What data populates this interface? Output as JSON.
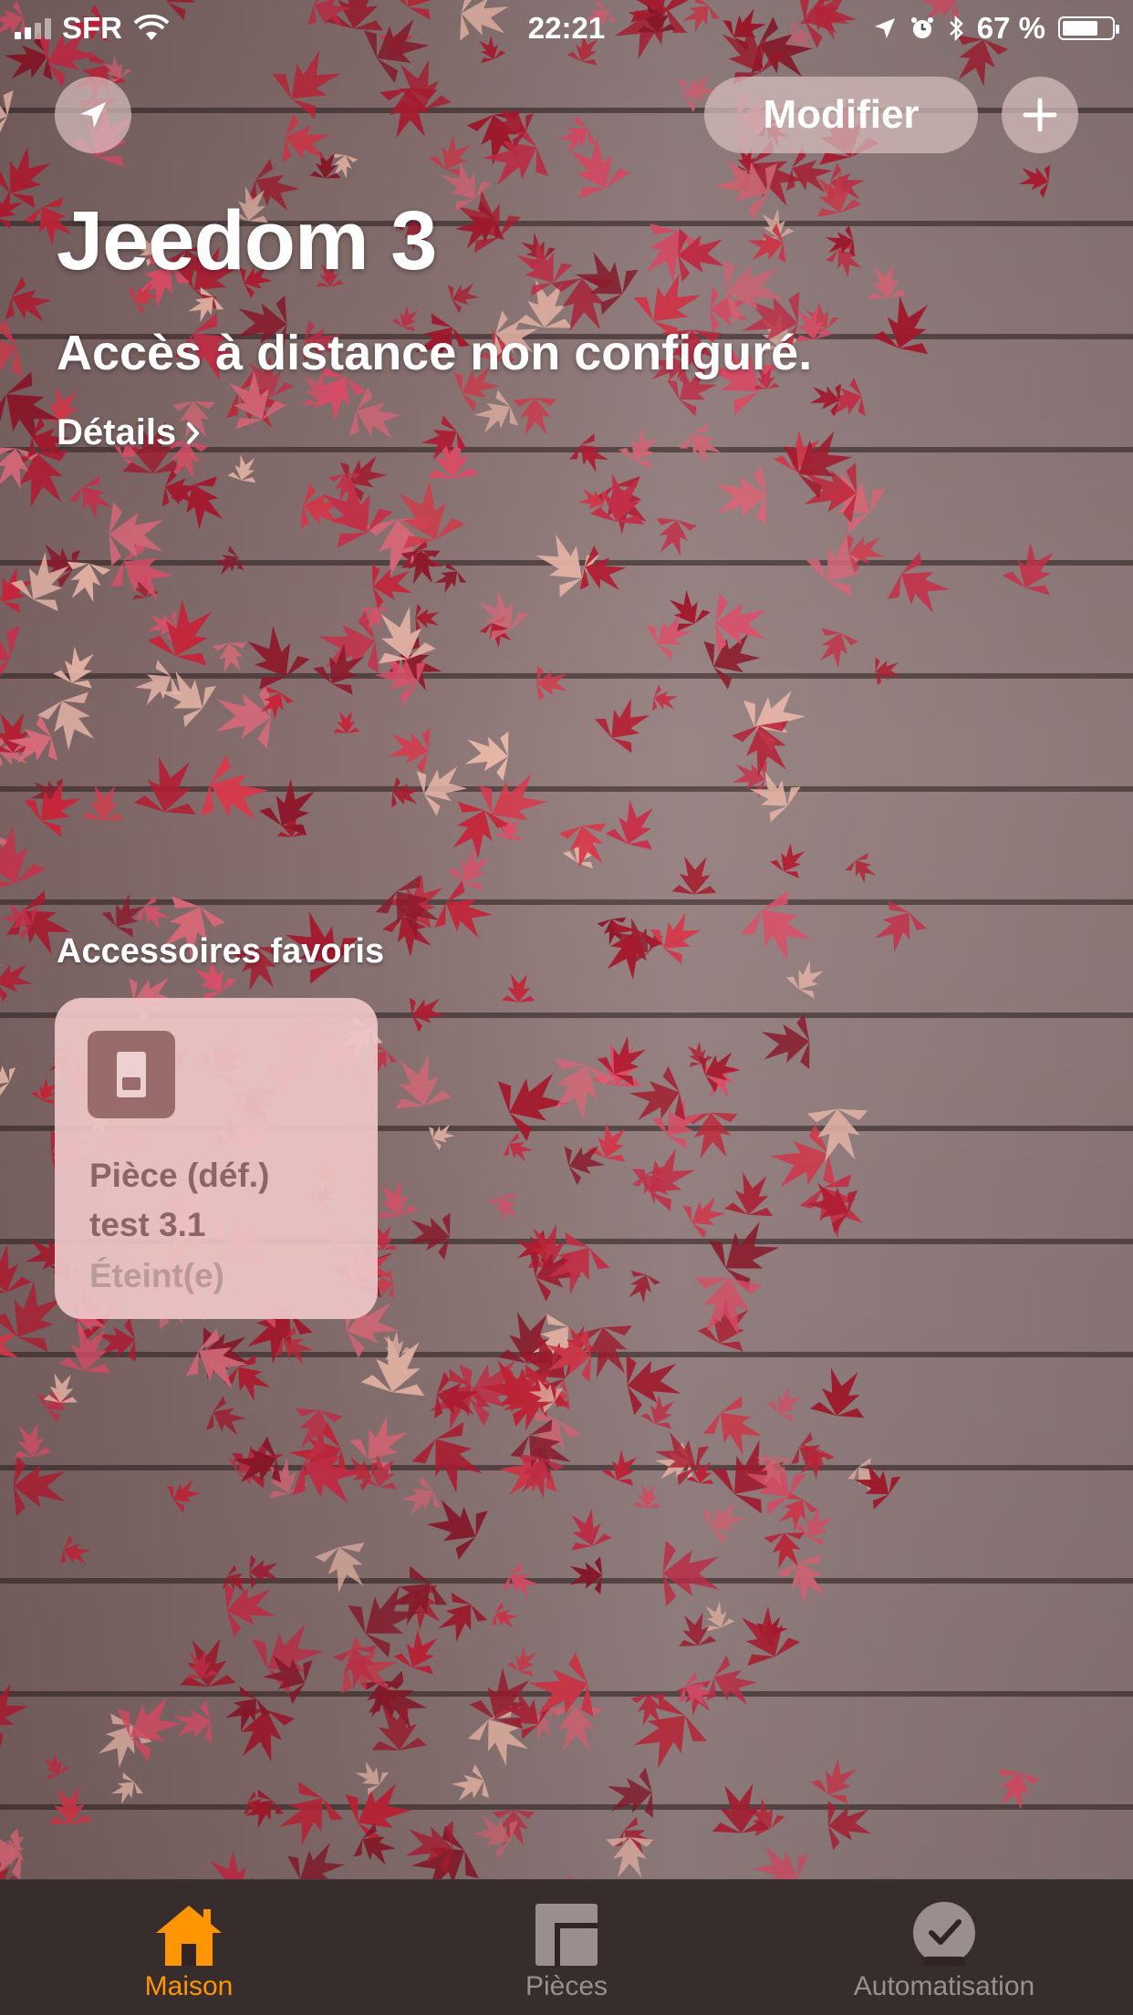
{
  "status_bar": {
    "carrier": "SFR",
    "time": "22:21",
    "battery": "67 %",
    "battery_level": 0.67
  },
  "header": {
    "edit_label": "Modifier",
    "home_title": "Jeedom 3",
    "notice": "Accès à distance non configuré.",
    "details_label": "Détails"
  },
  "favorites": {
    "section_title": "Accessoires favoris",
    "items": [
      {
        "room": "Pièce (déf.)",
        "name": "test 3.1",
        "state": "Éteint(e)"
      }
    ]
  },
  "tab_bar": {
    "tabs": [
      {
        "label": "Maison",
        "icon": "house-icon",
        "active": true
      },
      {
        "label": "Pièces",
        "icon": "rooms-icon",
        "active": false
      },
      {
        "label": "Automatisation",
        "icon": "automation-clock-icon",
        "active": false
      }
    ],
    "active_color": "#FF9500",
    "inactive_color": "#9a8e8e"
  }
}
